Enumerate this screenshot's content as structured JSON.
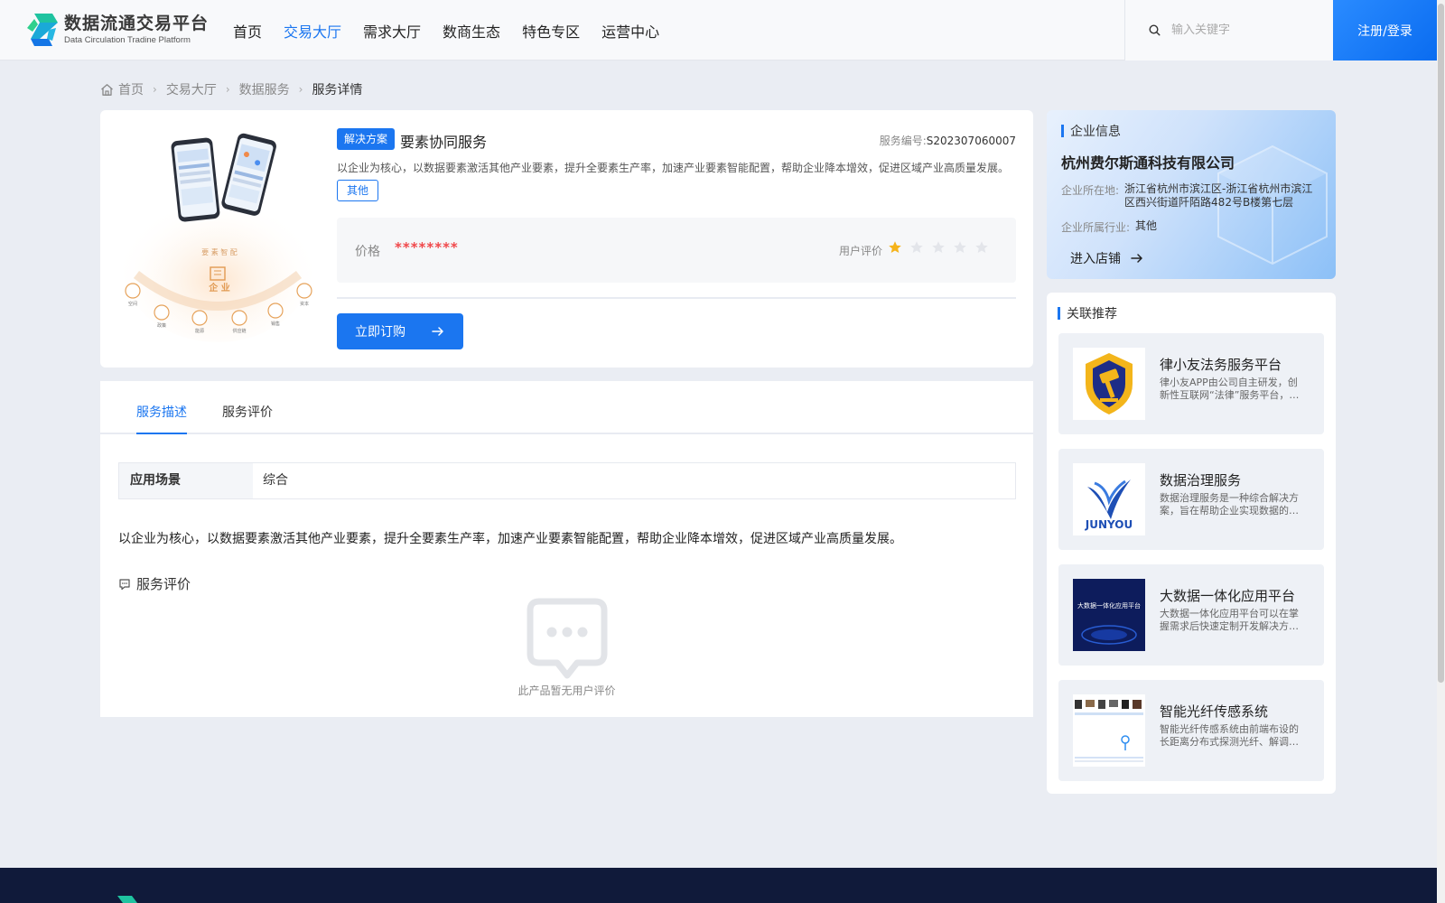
{
  "header": {
    "logo_cn": "数据流通交易平台",
    "logo_en": "Data Circulation Tradine Platform",
    "nav": [
      {
        "label": "首页",
        "active": false
      },
      {
        "label": "交易大厅",
        "active": true
      },
      {
        "label": "需求大厅",
        "active": false
      },
      {
        "label": "数商生态",
        "active": false
      },
      {
        "label": "特色专区",
        "active": false
      },
      {
        "label": "运营中心",
        "active": false
      }
    ],
    "search_placeholder": "输入关键字",
    "login_label": "注册/登录"
  },
  "breadcrumb": [
    "首页",
    "交易大厅",
    "数据服务",
    "服务详情"
  ],
  "product": {
    "type_tag": "解决方案",
    "title": "要素协同服务",
    "code_label": "服务编号:",
    "code": "S202307060007",
    "description": "以企业为核心，以数据要素激活其他产业要素，提升全要素生产率，加速产业要素智能配置，帮助企业降本增效，促进区域产业高质量发展。",
    "category_tag": "其他",
    "price_label": "价格",
    "price_value": "********",
    "rating_label": "用户评价",
    "rating": 1,
    "rating_max": 5,
    "buy_label": "立即订购",
    "image_labels": {
      "center": "企 业",
      "arc": "要 素 智 配",
      "nodes": [
        "空间",
        "政策",
        "能源",
        "供应链",
        "销售",
        "资本"
      ]
    }
  },
  "tabs": [
    {
      "label": "服务描述",
      "active": true
    },
    {
      "label": "服务评价",
      "active": false
    }
  ],
  "detail": {
    "scene_key": "应用场景",
    "scene_value": "综合",
    "text": "以企业为核心，以数据要素激活其他产业要素，提升全要素生产率，加速产业要素智能配置，帮助企业降本增效，促进区域产业高质量发展。",
    "review_title": "服务评价",
    "empty_text": "此产品暂无用户评价"
  },
  "company": {
    "section_title": "企业信息",
    "name": "杭州费尔斯通科技有限公司",
    "location_label": "企业所在地:",
    "location": "浙江省杭州市滨江区-浙江省杭州市滨江区西兴街道阡陌路482号B楼第七层",
    "industry_label": "企业所属行业:",
    "industry": "其他",
    "shop_label": "进入店铺"
  },
  "recommend": {
    "section_title": "关联推荐",
    "items": [
      {
        "title": "律小友法务服务平台",
        "desc": "律小友APP由公司自主研发，创新性互联网“法律”服务平台，为用户提供专业便捷的法律服务。"
      },
      {
        "title": "数据治理服务",
        "desc": "数据治理服务是一种综合解决方案，旨在帮助企业实现数据的规范管理与价值挖掘。",
        "logo_text": "JUNYOU"
      },
      {
        "title": "大数据一体化应用平台",
        "desc": "大数据一体化应用平台可以在掌握需求后快速定制开发解决方案，满足多种业务场景。",
        "thumb_text": "大数据一体化应用平台"
      },
      {
        "title": "智能光纤传感系统",
        "desc": "智能光纤传感系统由前端布设的长距离分布式探测光纤、解调设备及管理平台组成。"
      }
    ]
  },
  "colors": {
    "primary": "#1b76f0",
    "price": "#f0484b",
    "star_on": "#f5b31b",
    "star_off": "#e3e5ea",
    "footer": "#101a3a"
  }
}
